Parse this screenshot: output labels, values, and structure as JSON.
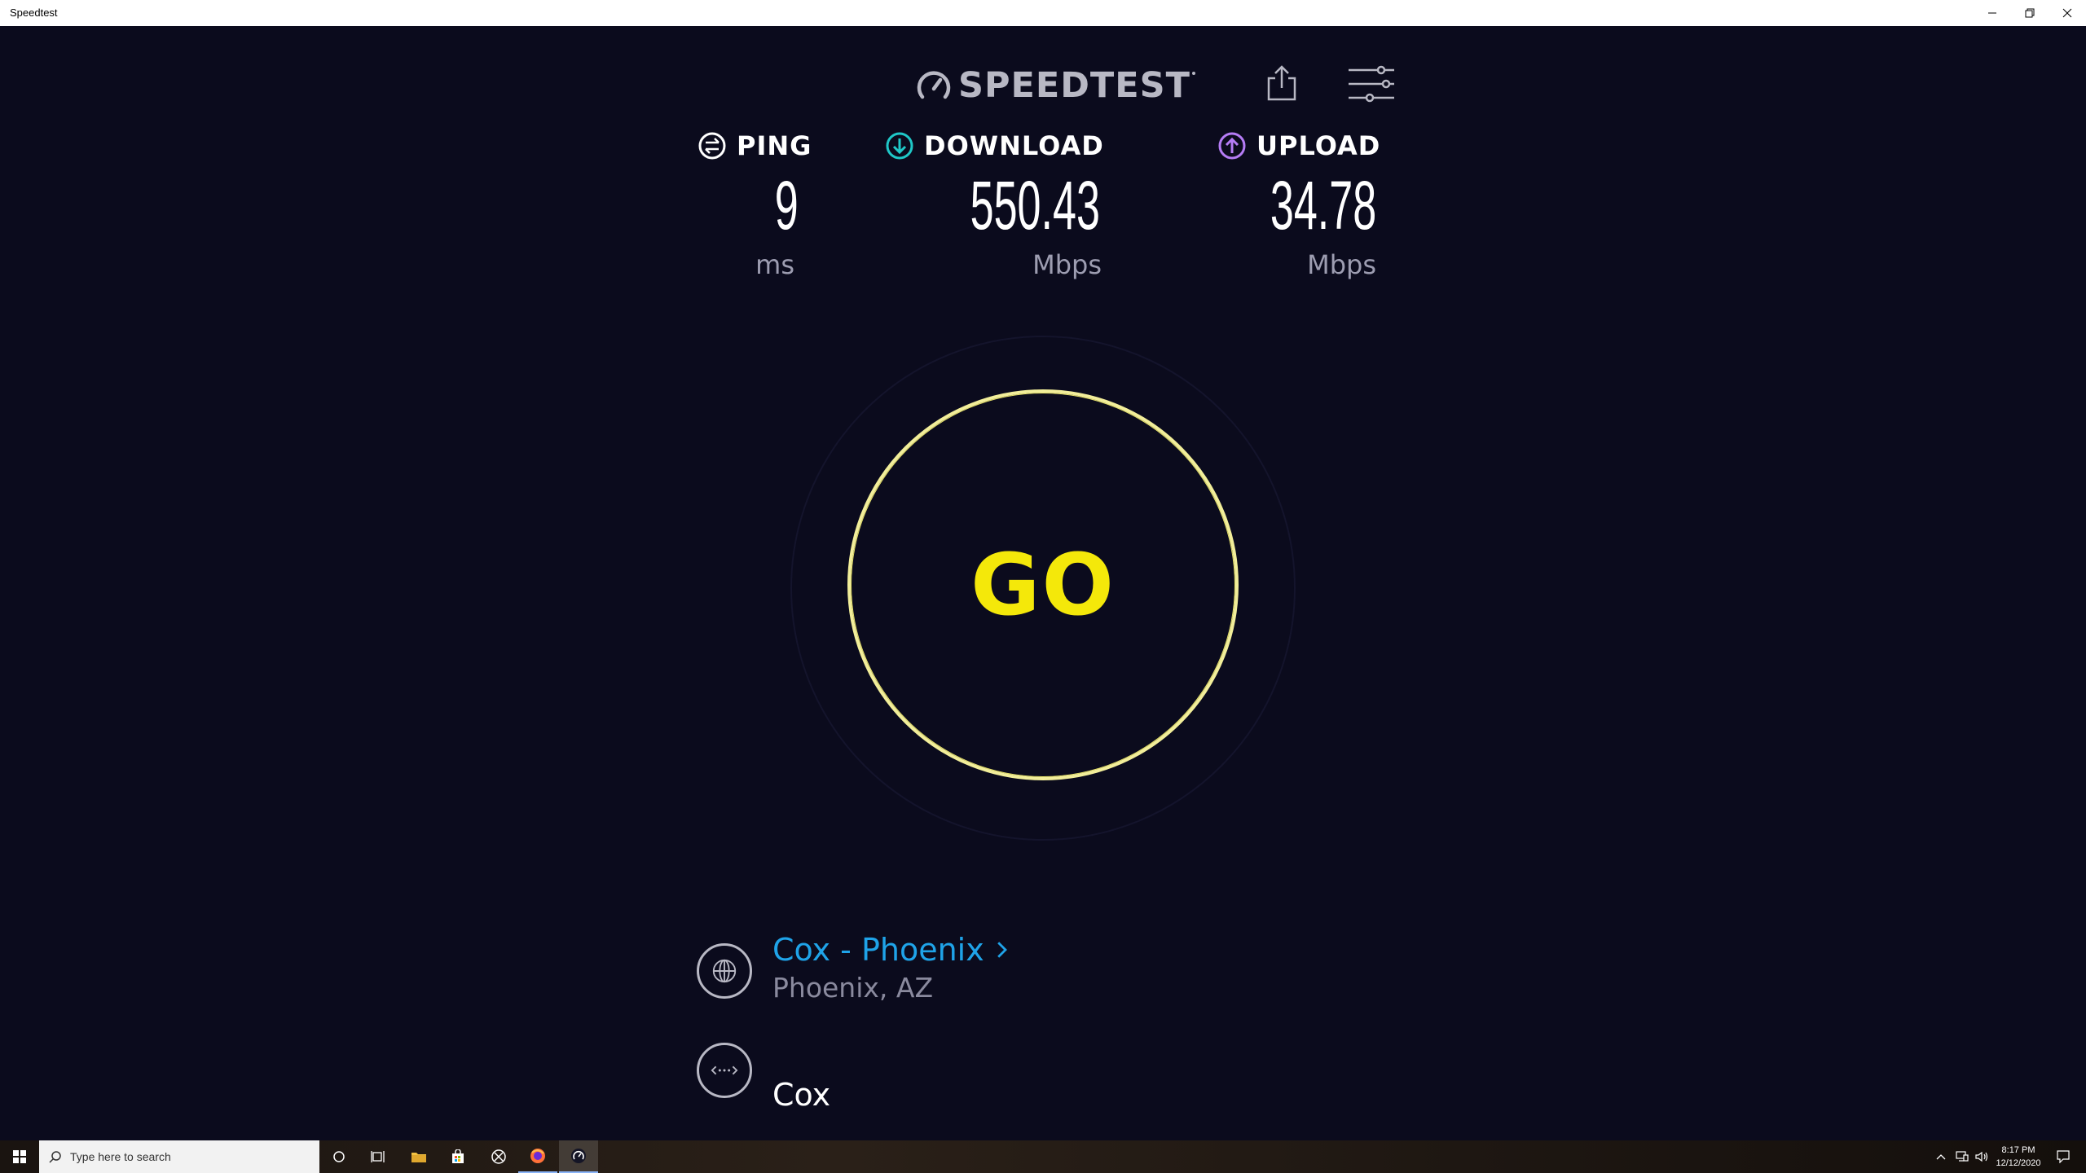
{
  "window": {
    "title": "Speedtest"
  },
  "header": {
    "logo_text": "SPEEDTEST",
    "share_icon": "share-icon",
    "settings_icon": "settings-sliders-icon"
  },
  "metrics": {
    "ping": {
      "label": "PING",
      "value": "9",
      "unit": "ms",
      "icon": "ping-icon",
      "color": "#ffffff"
    },
    "download": {
      "label": "DOWNLOAD",
      "value": "550.43",
      "unit": "Mbps",
      "icon": "download-arrow-icon",
      "color": "#1fc8c8"
    },
    "upload": {
      "label": "UPLOAD",
      "value": "34.78",
      "unit": "Mbps",
      "icon": "upload-arrow-icon",
      "color": "#b57cf5"
    }
  },
  "go_button": {
    "label": "GO",
    "color": "#f4e80a"
  },
  "server": {
    "name": "Cox - Phoenix",
    "location": "Phoenix, AZ",
    "icon": "globe-icon"
  },
  "isp": {
    "name": "Cox",
    "icon": "connection-icon"
  },
  "taskbar": {
    "search_placeholder": "Type here to search",
    "time": "8:17 PM",
    "date": "12/12/2020"
  }
}
